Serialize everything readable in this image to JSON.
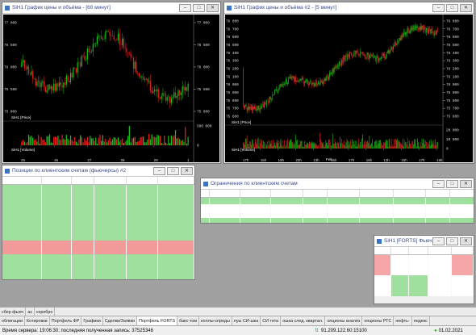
{
  "win1": {
    "title": "SiH1 График цены и объёма - [60 минут]",
    "yticks": [
      "77 000",
      "76 500",
      "76 000",
      "75 500",
      "75 000"
    ],
    "price_label": "SiH1 [Price]",
    "volume_label": "SiH1 [Volume]",
    "vol_ticks": [
      "500 000",
      "0"
    ],
    "xticks": [
      "25",
      "26",
      "27",
      "28",
      "29",
      "1"
    ],
    "colors": {
      "up": "#19c219",
      "down": "#e81f1f"
    }
  },
  "win2": {
    "title": "SiH1 График цены и объёма #2 - [5 минут]",
    "yticks": [
      "76 800",
      "76 700",
      "76 600",
      "76 500",
      "76 400",
      "76 300",
      "76 200",
      "76 100",
      "76 000",
      "75 900",
      "75 800",
      "75 700",
      "75 600"
    ],
    "price_label": "SiH1 [Price]",
    "volume_label": "SiH1 [Volume]",
    "vol_ticks": [
      "20 000",
      "10 000",
      "0"
    ],
    "xticks": [
      "17h",
      "15h",
      "19h",
      "23h",
      "13h",
      "15h",
      "17h",
      "19h",
      "13h",
      "15h",
      "17h",
      "19h"
    ],
    "xbottom": "Feb"
  },
  "pos": {
    "title": "Позиции по клиентским счетам (фьючерсы) #2",
    "headers": [
      "Код инструмента",
      "Дата пога",
      "Тек. чист.",
      "Вариац. маржа",
      "Эффект. цена",
      "Суммарная в."
    ],
    "rows": [
      [
        "SiM0000BF1",
        "17.06.2021",
        "40",
        "240,00",
        "242",
        "1 240,00",
        "g"
      ],
      [
        "SiH1",
        "18.03.2021",
        "2",
        "246,00",
        "76 364",
        "-166,00",
        "g"
      ],
      [
        "Si800000C1",
        "18.03.2021",
        "40",
        "240,00",
        "621",
        "2 800,00",
        "g"
      ],
      [
        "SiVH1",
        "18.03.2021",
        "-14",
        "4 581,54",
        "28,92",
        "8 182,48",
        "g"
      ],
      [
        "SiV28C1",
        "18.03.2021",
        "-10",
        "1 674,30",
        "2,64",
        "2 732,50",
        "g"
      ],
      [
        "SiV28O1",
        "18.03.2021",
        "20",
        "304,40",
        "1,22",
        "-1 214,40",
        "g"
      ],
      [
        "RBH1",
        "18.03.2021",
        "-4",
        "2 800,68",
        "136 650",
        "2 064,57",
        "g"
      ],
      [
        "Si76000BN1",
        "18.02.2021",
        "-12",
        "720,00",
        "786",
        "3 588,00",
        "g"
      ],
      [
        "RI150000BB1",
        "18.02.2021",
        "8",
        "-365,28",
        "290",
        "-1 700,24",
        "r"
      ],
      [
        "RI150000BN1",
        "18.02.2021",
        "-1",
        "-334,86",
        "3 080",
        "394,69",
        "r"
      ],
      [
        "RI125000BN1",
        "18.02.2021",
        "15",
        "2 054,85",
        "820",
        "-3 643,35",
        "g"
      ],
      [
        "Si79000BB1A",
        "04.02.2021",
        "40",
        "320,00",
        "26",
        "-1 320,00",
        "g"
      ],
      [
        "Si78000BB1A",
        "04.02.2021",
        "20",
        "440,00",
        "73",
        "-720,00",
        "g"
      ],
      [
        "Si77000BB1A",
        "04.02.2021",
        "40",
        "2 200,00",
        "229",
        "40,00",
        "g"
      ],
      [
        "Si76500BN1A",
        "04.02.2021",
        "-10",
        "490,00",
        "531",
        "4 020,00",
        "g"
      ],
      [
        "Si74500BN1A",
        "04.02.2021",
        "40",
        "640,00",
        "19",
        "-2 640,00",
        "g"
      ]
    ]
  },
  "lim": {
    "title": "Ограничения по клиентским счетам",
    "headers": [
      "Предыд. лимит",
      "Лимит откр. п",
      "Тек.чист.поз.",
      "Тек.чист.поз.(",
      "План.чист.поз.",
      "Вариац. маржа",
      "Накоплен. д",
      "Биржевые"
    ],
    "rows": [
      [
        "247 156,66",
        "260 709,17",
        "230 236,96",
        "0,00",
        "230 836,39",
        "30 470,27",
        "18 051,63",
        "-1,94",
        "-1,9",
        "g"
      ],
      [
        "142 768,82",
        "142 768,82",
        "0,00",
        "0,00",
        "0,00",
        "0,00",
        "0,00",
        "0,00",
        "0,0",
        "w"
      ],
      [
        "142 768,82",
        "142 768,82",
        "0,00",
        "0,00",
        "0,00",
        "0,00",
        "0,00",
        "0,00",
        "0,0",
        "w"
      ],
      [
        "105,74",
        "0,00",
        "0,00",
        "0,00",
        "129 216,31",
        "-91 119,27",
        "13 658,25",
        "0,00",
        "105,7",
        "g"
      ]
    ],
    "row_idx": [
      "1",
      "2",
      "3",
      "4"
    ]
  },
  "quote": {
    "title": "SiH1 [FORTS] Фьюч...",
    "headers": [
      "Продаж",
      "Цена",
      "Покупка",
      "Своя п",
      "Своя п"
    ],
    "rows": [
      [
        "67",
        "76 457",
        "",
        "",
        "",
        "s"
      ],
      [
        "6",
        "76 456",
        "",
        "",
        "",
        "s"
      ],
      [
        "1",
        "76 455",
        "",
        "",
        "",
        "s"
      ],
      [
        "",
        "76 453",
        "2",
        "",
        "",
        "b"
      ],
      [
        "",
        "76 452",
        "6",
        "",
        "",
        "b"
      ],
      [
        "",
        "76 451",
        "2",
        "",
        "",
        "b"
      ]
    ]
  },
  "tabs1": [
    "сбер фьюч",
    "аз",
    "серебро"
  ],
  "tabs2": [
    "облигации",
    "Котировки",
    "Портфель ФР",
    "Графики",
    "Сделки/Заявки",
    "Портфель FORTS",
    "бакс-том",
    "коллы-спреды",
    "пуы СИ-шка",
    "СИ тета",
    "ошка след. квартал.",
    "опционы анализ",
    "опционы РТС",
    "нефть-",
    "яндекс"
  ],
  "active_tab": "Портфель FORTS",
  "status": {
    "server": "Время сервера: 19:06:30; последняя полученная запись: 37525346",
    "ip": "91.209.122.60:15100",
    "date": "01.02.2021"
  }
}
